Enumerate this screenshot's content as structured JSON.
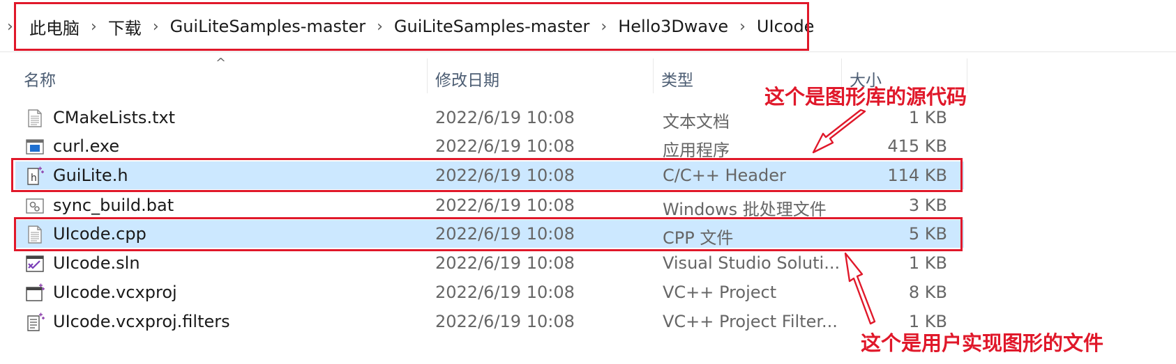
{
  "breadcrumb": {
    "items": [
      "此电脑",
      "下载",
      "GuiLiteSamples-master",
      "GuiLiteSamples-master",
      "Hello3Dwave",
      "UIcode"
    ]
  },
  "columns": {
    "name": "名称",
    "modified": "修改日期",
    "type": "类型",
    "size": "大小"
  },
  "files": [
    {
      "name": "CMakeLists.txt",
      "modified": "2022/6/19 10:08",
      "type": "文本文档",
      "size": "1 KB",
      "icon": "text-file-icon",
      "selected": false
    },
    {
      "name": "curl.exe",
      "modified": "2022/6/19 10:08",
      "type": "应用程序",
      "size": "415 KB",
      "icon": "exe-icon",
      "selected": false
    },
    {
      "name": "GuiLite.h",
      "modified": "2022/6/19 10:08",
      "type": "C/C++ Header",
      "size": "114 KB",
      "icon": "header-file-icon",
      "selected": true
    },
    {
      "name": "sync_build.bat",
      "modified": "2022/6/19 10:08",
      "type": "Windows 批处理文件",
      "size": "3 KB",
      "icon": "batch-file-icon",
      "selected": false
    },
    {
      "name": "UIcode.cpp",
      "modified": "2022/6/19 10:08",
      "type": "CPP 文件",
      "size": "5 KB",
      "icon": "cpp-file-icon",
      "selected": true
    },
    {
      "name": "UIcode.sln",
      "modified": "2022/6/19 10:08",
      "type": "Visual Studio Soluti...",
      "size": "1 KB",
      "icon": "visual-studio-icon",
      "selected": false
    },
    {
      "name": "UIcode.vcxproj",
      "modified": "2022/6/19 10:08",
      "type": "VC++ Project",
      "size": "8 KB",
      "icon": "vcxproj-icon",
      "selected": false
    },
    {
      "name": "UIcode.vcxproj.filters",
      "modified": "2022/6/19 10:08",
      "type": "VC++ Project Filter...",
      "size": "1 KB",
      "icon": "filters-file-icon",
      "selected": false
    }
  ],
  "annotations": {
    "top": "这个是图形库的源代码",
    "bottom": "这个是用户实现图形的文件"
  },
  "colors": {
    "highlight": "#e0182a",
    "selection": "#cce8ff"
  }
}
